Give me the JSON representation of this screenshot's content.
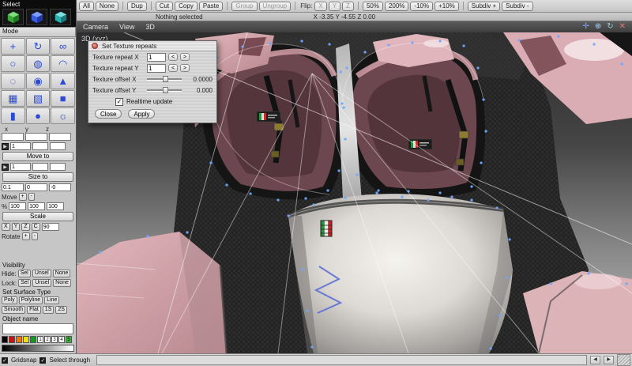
{
  "toolbar": {
    "buttons": [
      {
        "label": "All"
      },
      {
        "label": "None"
      },
      {
        "label": "Dup"
      },
      {
        "label": "Cut"
      },
      {
        "label": "Copy"
      },
      {
        "label": "Paste"
      },
      {
        "label": "Group"
      },
      {
        "label": "Ungroup"
      },
      {
        "label": "Flip:"
      },
      {
        "label": "X"
      },
      {
        "label": "Y"
      },
      {
        "label": "Z"
      },
      {
        "label": "50%"
      },
      {
        "label": "200%"
      },
      {
        "label": "-10%"
      },
      {
        "label": "+10%"
      },
      {
        "label": "Subdiv +"
      },
      {
        "label": "Subdiv -"
      }
    ]
  },
  "statusbar": {
    "selection": "Nothing selected",
    "coordinates": "X -3.35 Y -4.55 Z 0.00"
  },
  "viewport": {
    "menus": [
      "Camera",
      "View",
      "3D"
    ],
    "label": "3D (xyz)",
    "nav_icons": [
      {
        "name": "pan",
        "glyph": "✛"
      },
      {
        "name": "zoom",
        "glyph": "⊕"
      },
      {
        "name": "orbit",
        "glyph": "↻"
      },
      {
        "name": "close",
        "glyph": "✕"
      }
    ]
  },
  "dialog": {
    "title": "Set Texture repeats",
    "rows": [
      {
        "label": "Texture repeat X",
        "value": "1"
      },
      {
        "label": "Texture repeat Y",
        "value": "1"
      },
      {
        "label": "Texture offset X",
        "value": "0.0000"
      },
      {
        "label": "Texture offset Y",
        "value": "0.000"
      }
    ],
    "stepper_dec": "<",
    "stepper_inc": ">",
    "checkbox_label": "Realtime update",
    "checkbox_checked": true,
    "check_glyph": "✓",
    "close_label": "Close",
    "apply_label": "Apply"
  },
  "sidebar": {
    "select_label": "Select",
    "mode_label": "Mode",
    "tools": [
      {
        "name": "move",
        "glyph": "+"
      },
      {
        "name": "rotate",
        "glyph": "↻"
      },
      {
        "name": "lasso",
        "glyph": "∞"
      },
      {
        "name": "ellipse",
        "glyph": "○"
      },
      {
        "name": "wire-sphere",
        "glyph": "◍"
      },
      {
        "name": "arc",
        "glyph": "◠"
      },
      {
        "name": "ring",
        "glyph": "◌"
      },
      {
        "name": "geosphere",
        "glyph": "◉"
      },
      {
        "name": "cone",
        "glyph": "▲"
      },
      {
        "name": "grid-plane",
        "glyph": "▦"
      },
      {
        "name": "wire-cube",
        "glyph": "▧"
      },
      {
        "name": "cube",
        "glyph": "■"
      },
      {
        "name": "cylinder",
        "glyph": "▮"
      },
      {
        "name": "sphere",
        "glyph": "●"
      },
      {
        "name": "light",
        "glyph": "☼"
      }
    ],
    "axes": [
      "x",
      "y",
      "z"
    ],
    "move_to": {
      "value": "1",
      "button": "Move to"
    },
    "size_to": {
      "value": "1",
      "button": "Size to"
    },
    "move_row": {
      "values": [
        "0.1",
        "0",
        "-0"
      ],
      "label": "Move",
      "plus": "+",
      "minus": "-"
    },
    "scale_row": {
      "percent": "%",
      "values": [
        "100",
        "100",
        "100"
      ],
      "button": "Scale"
    },
    "rotate_row": {
      "axes": [
        "X",
        "Y",
        "Z",
        "C"
      ],
      "angle": "90",
      "label": "Rotate",
      "plus": "+",
      "minus": "-"
    },
    "visibility": {
      "title": "Visibility",
      "hide": "Hide:",
      "lock": "Lock:",
      "options": [
        "Sel",
        "Unsel",
        "None"
      ]
    },
    "surface": {
      "title": "Set Surface Type",
      "row1": [
        "Poly",
        "Polyline",
        "Line"
      ],
      "row2": [
        "Smooth",
        "Flat",
        "1S",
        "2S"
      ]
    },
    "object_name": {
      "label": "Object name",
      "value": ""
    },
    "palette": {
      "colors": [
        "#000000",
        "#cc1111",
        "#ee7711",
        "#eedd11",
        "#119922"
      ],
      "numbers": [
        "1",
        "2",
        "3",
        "4",
        "5"
      ]
    }
  },
  "bottombar": {
    "gridsnap_label": "Gridsnap",
    "gridsnap_checked": true,
    "select_through_label": "Select through",
    "select_through_checked": true
  },
  "colors": {
    "tool_icon_blue": "#2b4bd7",
    "vertex_blue": "#6fa8ff",
    "seat_maroon": "#6d4750",
    "body_pink": "#dcb4b8"
  }
}
